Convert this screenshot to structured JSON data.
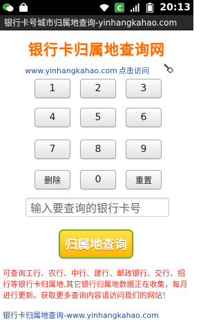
{
  "status_bar": {
    "time": "20:13",
    "icons": [
      "wechat-icon",
      "notification-bag-icon",
      "wifi-icon",
      "c-app-icon",
      "signal-icon",
      "battery-icon"
    ]
  },
  "title_bar": {
    "title": "银行卡号城市归属地查询-yinhangkahao.com"
  },
  "banner": {
    "title": "银行卡归属地查询网",
    "url": "www.yinhangkahao.com",
    "visit_label": "点击访问"
  },
  "keypad": {
    "keys": [
      {
        "label": "1"
      },
      {
        "label": "2"
      },
      {
        "label": "3"
      },
      {
        "label": "4"
      },
      {
        "label": "5"
      },
      {
        "label": "6"
      },
      {
        "label": "7"
      },
      {
        "label": "8"
      },
      {
        "label": "9"
      },
      {
        "label": "删除"
      },
      {
        "label": "0"
      },
      {
        "label": "重置"
      }
    ]
  },
  "input": {
    "placeholder": "输入要查询的银行卡号"
  },
  "query_button": {
    "label": "归属地查询"
  },
  "info": {
    "text": "可查询工行、农行、中行、建行、邮政银行、交行、招行等银行卡归属地,其它银行归属地数据正在收集，每月进行更新。获取更多查询内容请访问我们的网站！"
  },
  "footer": {
    "text": "银行卡归属地查询-www.yinhangkahao.com"
  },
  "colors": {
    "banner_orange": "#ff6a00",
    "link_blue": "#1f4fb5",
    "info_red": "#ff2a1a",
    "button_yellow": "#ffc21a",
    "button_green_border": "#7bb01d"
  }
}
